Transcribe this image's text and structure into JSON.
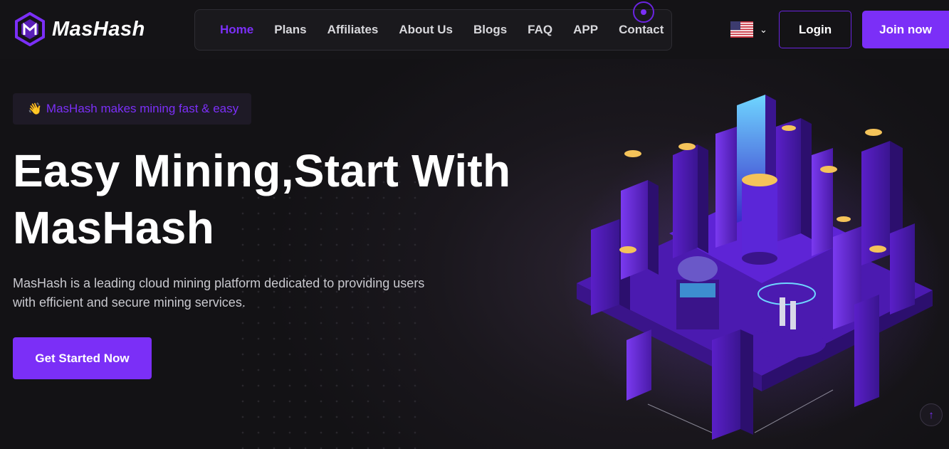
{
  "header": {
    "logo_text": "MasHash",
    "nav": [
      {
        "label": "Home",
        "active": true
      },
      {
        "label": "Plans"
      },
      {
        "label": "Affiliates"
      },
      {
        "label": "About Us"
      },
      {
        "label": "Blogs"
      },
      {
        "label": "FAQ"
      },
      {
        "label": "APP"
      },
      {
        "label": "Contact"
      }
    ],
    "language_icon": "us-flag-icon",
    "login_label": "Login",
    "join_label": "Join now"
  },
  "hero": {
    "badge_emoji": "👋",
    "badge_text": "MasHash makes mining fast & easy",
    "title_line1": "Easy Mining,Start With",
    "title_line2": "MasHash",
    "description": "MasHash is a leading cloud mining platform dedicated to providing users with efficient and secure mining services.",
    "cta_label": "Get Started Now"
  },
  "colors": {
    "accent": "#7b2ff7",
    "background": "#121114"
  },
  "icons": {
    "logo": "mashash-logo-icon",
    "chevron": "chevron-down-icon",
    "scroll_top": "arrow-up-icon"
  }
}
